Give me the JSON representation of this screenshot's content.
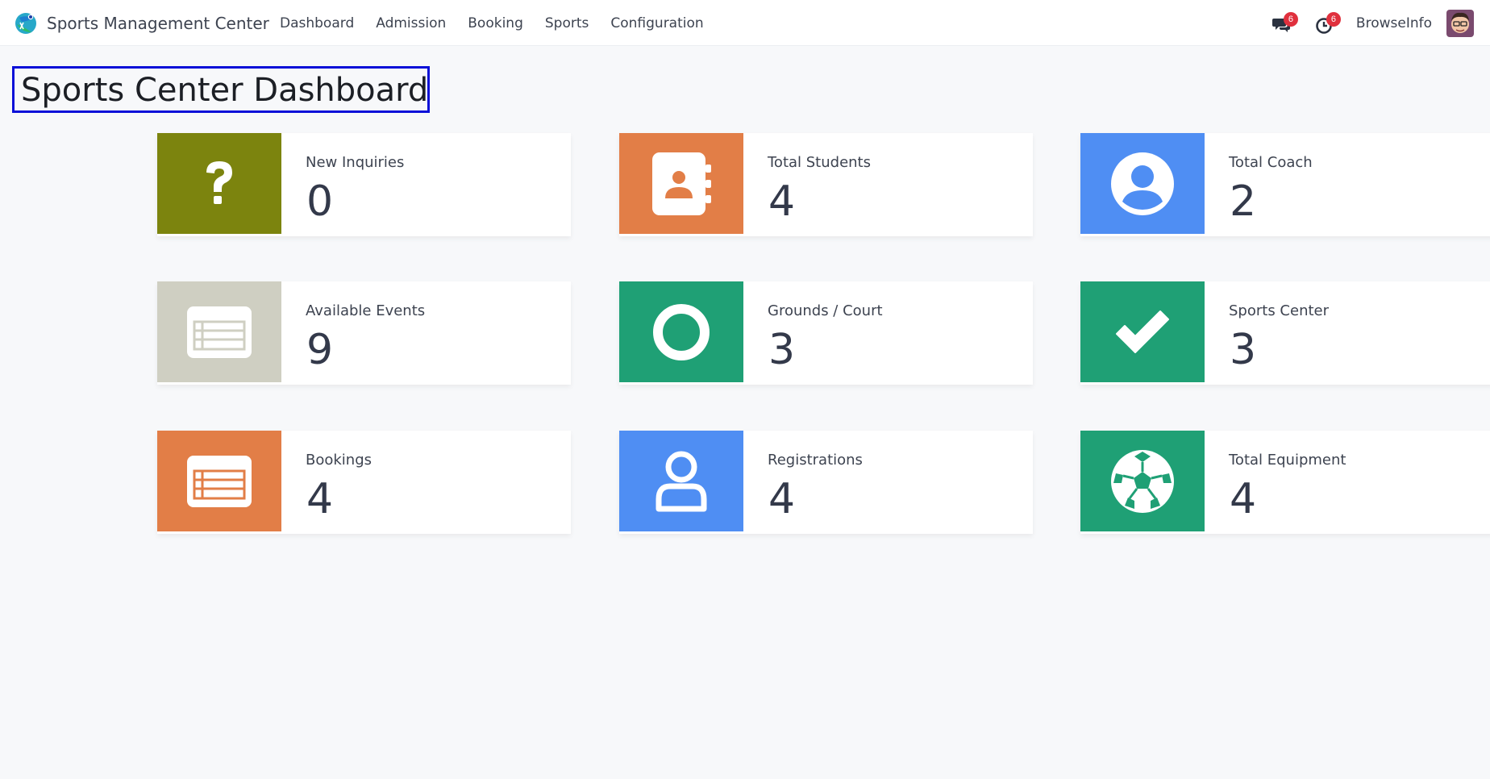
{
  "navbar": {
    "brand": "Sports Management Center",
    "menu": [
      "Dashboard",
      "Admission",
      "Booking",
      "Sports",
      "Configuration"
    ],
    "messages_count": "6",
    "activities_count": "6",
    "company": "BrowseInfo",
    "icons": {
      "brand": "app-logo-icon",
      "messages": "chat-bubbles-icon",
      "activities": "clock-icon",
      "avatar": "user-avatar"
    }
  },
  "page": {
    "title": "Sports Center Dashboard"
  },
  "cards": [
    {
      "label": "New Inquiries",
      "value": "0",
      "color": "#7c840e",
      "icon": "question-icon"
    },
    {
      "label": "Total Students",
      "value": "4",
      "color": "#e27e47",
      "icon": "address-book-icon"
    },
    {
      "label": "Total Coach",
      "value": "2",
      "color": "#4f8ef3",
      "icon": "user-circle-icon"
    },
    {
      "label": "Available Events",
      "value": "9",
      "color": "#cfcfc2",
      "icon": "list-icon"
    },
    {
      "label": "Grounds / Court",
      "value": "3",
      "color": "#1fa075",
      "icon": "circle-icon"
    },
    {
      "label": "Sports Center",
      "value": "3",
      "color": "#1fa075",
      "icon": "check-icon"
    },
    {
      "label": "Bookings",
      "value": "4",
      "color": "#e27e47",
      "icon": "list-icon"
    },
    {
      "label": "Registrations",
      "value": "4",
      "color": "#4f8ef3",
      "icon": "user-outline-icon"
    },
    {
      "label": "Total Equipment",
      "value": "4",
      "color": "#1fa075",
      "icon": "soccer-ball-icon"
    }
  ]
}
